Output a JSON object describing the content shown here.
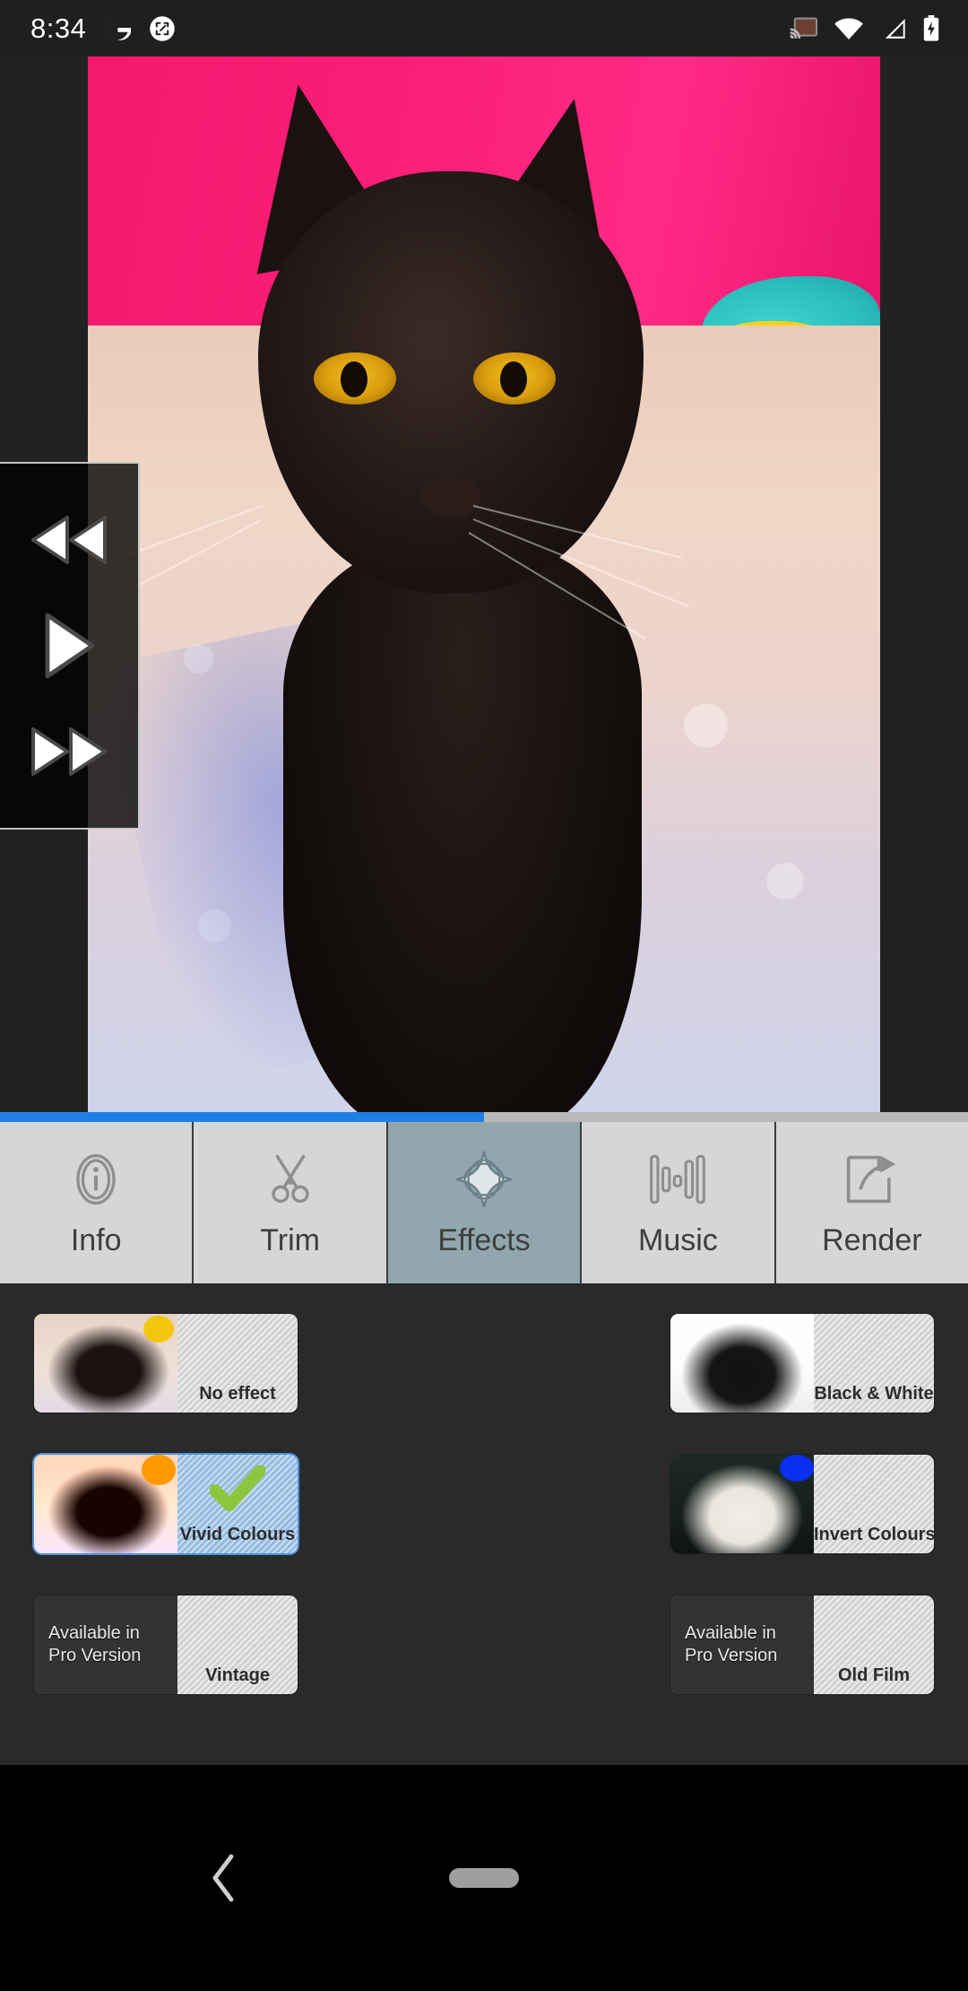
{
  "status_bar": {
    "clock": "8:34",
    "left_icons": [
      {
        "name": "google-icon",
        "glyph": "G"
      },
      {
        "name": "screenshot-edit-icon",
        "glyph": "edit"
      }
    ],
    "right_icons": [
      {
        "name": "cast-icon"
      },
      {
        "name": "wifi-icon"
      },
      {
        "name": "cellular-signal-icon"
      },
      {
        "name": "battery-charging-icon"
      }
    ]
  },
  "player": {
    "controls": [
      {
        "name": "rewind-button",
        "label": "Rewind"
      },
      {
        "name": "play-button",
        "label": "Play"
      },
      {
        "name": "fast-forward-button",
        "label": "Fast forward"
      }
    ],
    "seek_percent": 50
  },
  "tabs": [
    {
      "id": "info",
      "label": "Info",
      "icon": "info-icon",
      "selected": false
    },
    {
      "id": "trim",
      "label": "Trim",
      "icon": "scissors-icon",
      "selected": false
    },
    {
      "id": "effects",
      "label": "Effects",
      "icon": "sparkle-icon",
      "selected": true
    },
    {
      "id": "music",
      "label": "Music",
      "icon": "waveform-icon",
      "selected": false
    },
    {
      "id": "render",
      "label": "Render",
      "icon": "export-icon",
      "selected": false
    }
  ],
  "effects": [
    {
      "id": "no-effect",
      "label": "No effect",
      "selected": false,
      "locked": false,
      "thumb": "normal"
    },
    {
      "id": "black-and-white",
      "label": "Black & White",
      "selected": false,
      "locked": false,
      "thumb": "bw"
    },
    {
      "id": "vivid-colours",
      "label": "Vivid Colours",
      "selected": true,
      "locked": false,
      "thumb": "vivid"
    },
    {
      "id": "invert-colours",
      "label": "Invert Colours",
      "selected": false,
      "locked": false,
      "thumb": "invert"
    },
    {
      "id": "vintage",
      "label": "Vintage",
      "selected": false,
      "locked": true,
      "thumb": "pro"
    },
    {
      "id": "old-film",
      "label": "Old Film",
      "selected": false,
      "locked": true,
      "thumb": "pro"
    }
  ],
  "pro_badge": {
    "line1": "Available in",
    "line2": "Pro Version"
  },
  "nav_bar": {
    "back_label": "Back",
    "home_label": "Home"
  },
  "colors": {
    "accent_blue": "#1f7fe8",
    "selected_tab": "#91a6ad",
    "tab_bar": "#d5d6d7",
    "panel_bg": "#2a2a2a",
    "selected_effect": "#9cc3e8",
    "check_green": "#8cc63e"
  }
}
